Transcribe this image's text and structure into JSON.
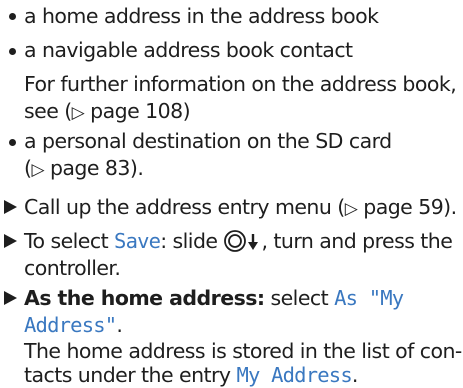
{
  "list_items": [
    {
      "text": "a home address in the address book"
    },
    {
      "text": "a navigable address book contact"
    },
    {
      "text": "a personal destination on the SD card"
    }
  ],
  "further_info": {
    "line1": "For further information on the address book,",
    "line2_pre": "see (",
    "arrow": "▷",
    "line2_ref": " page 108)"
  },
  "sd_card_ref": {
    "pre": "(",
    "arrow": "▷",
    "ref": " page 83)."
  },
  "steps": [
    {
      "pre": "Call up the address entry menu (",
      "arrow": "▷",
      "ref": " page 59)."
    },
    {
      "pre": "To select ",
      "display": "Save",
      "mid": ": slide ",
      "control_icon": "controller-slide-down-icon",
      "post": ", turn and press the",
      "line2": "controller."
    },
    {
      "bold": "As the home address:",
      "pre": " select ",
      "display1": "As \"My",
      "display2": "Address\"",
      "post": "."
    }
  ],
  "note": {
    "line1": "The home address is stored in the list of con-",
    "line2_pre": "tacts under the entry ",
    "display": "My Address",
    "line2_post": "."
  },
  "colors": {
    "text": "#1e1e1e",
    "display_text": "#3a78c0"
  }
}
